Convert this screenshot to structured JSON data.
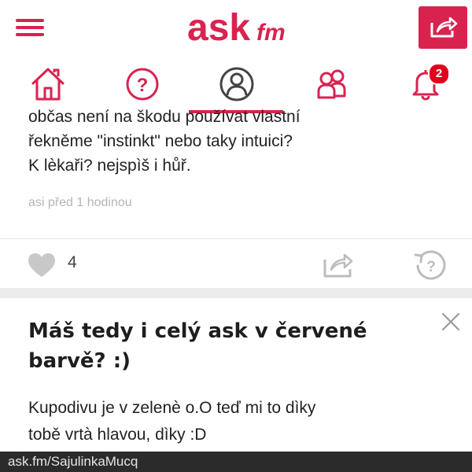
{
  "header": {
    "logo_text": "ask",
    "logo_suffix": "fm",
    "menu_icon": "hamburger-icon",
    "share_icon": "share-icon"
  },
  "nav": {
    "items": [
      {
        "icon": "home-icon"
      },
      {
        "icon": "question-icon"
      },
      {
        "icon": "profile-icon",
        "active": true
      },
      {
        "icon": "friends-icon"
      },
      {
        "icon": "bell-icon",
        "badge": "2"
      }
    ]
  },
  "answer": {
    "lines": [
      "občas není na škodu používat vlastní",
      "řekněme \"instinkt\" nebo taky intuici?",
      "K lèkaři? nejspìš i hůř."
    ],
    "time": "asi před 1 hodinou",
    "likes": "4"
  },
  "next_question": {
    "title_line1": "Máš tedy i celý ask v červené",
    "title_line2": "barvě? :)",
    "answer_line1": "Kupodivu je v zelenè o.O teď mi to dìky",
    "answer_line2": "tobě vrtà hlavou, dìky :D"
  },
  "footer": {
    "url": "ask.fm/SajulinkaMucq"
  },
  "colors": {
    "brand": "#d9234f",
    "badge": "#e0001c",
    "url_bar": "#2b2b2b"
  }
}
